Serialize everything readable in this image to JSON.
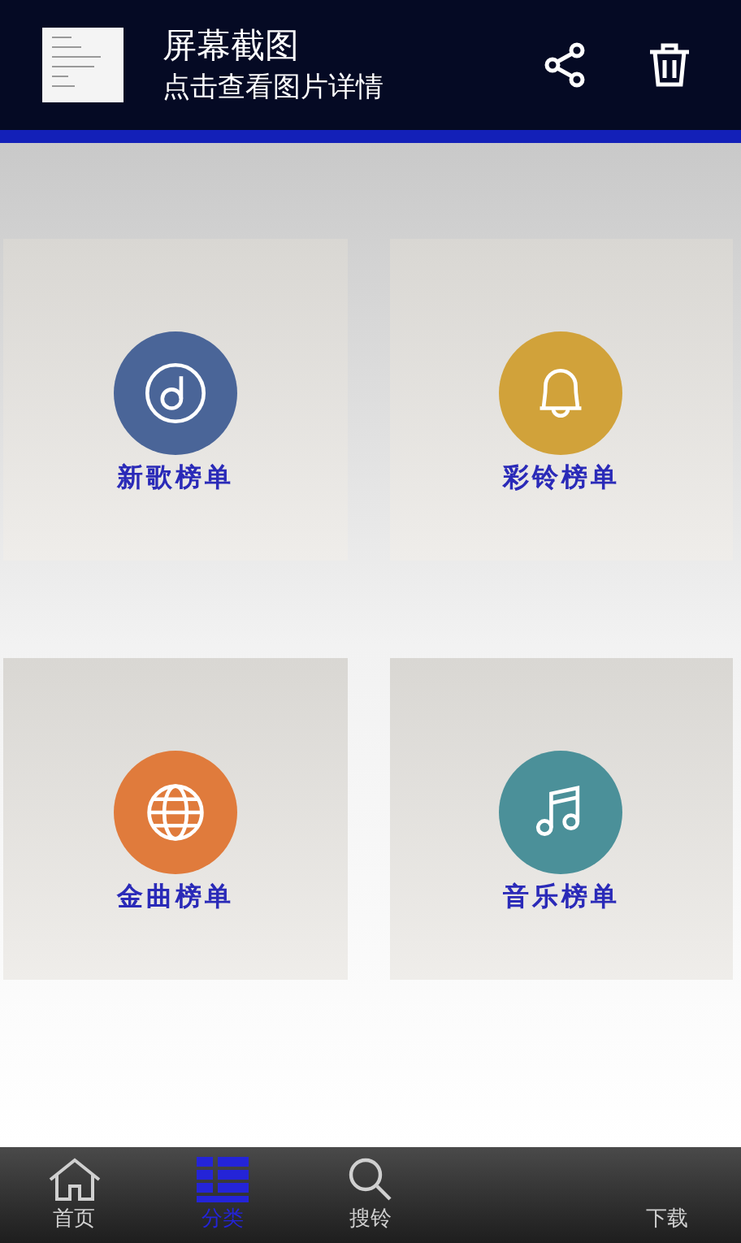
{
  "notification": {
    "title": "屏幕截图",
    "subtitle": "点击查看图片详情"
  },
  "categories": [
    {
      "label": "新歌榜单",
      "kind": "disc",
      "color": "#4a6598"
    },
    {
      "label": "彩铃榜单",
      "kind": "bell",
      "color": "#d1a23a"
    },
    {
      "label": "金曲榜单",
      "kind": "globe",
      "color": "#e07b3c"
    },
    {
      "label": "音乐榜单",
      "kind": "notes",
      "color": "#4b9099"
    }
  ],
  "tabs": [
    {
      "label": "首页",
      "kind": "home",
      "selected": false
    },
    {
      "label": "分类",
      "kind": "list",
      "selected": true
    },
    {
      "label": "搜铃",
      "kind": "search",
      "selected": false
    },
    {
      "kind": "spacer"
    },
    {
      "label": "下载",
      "kind": "blank",
      "selected": false
    }
  ]
}
